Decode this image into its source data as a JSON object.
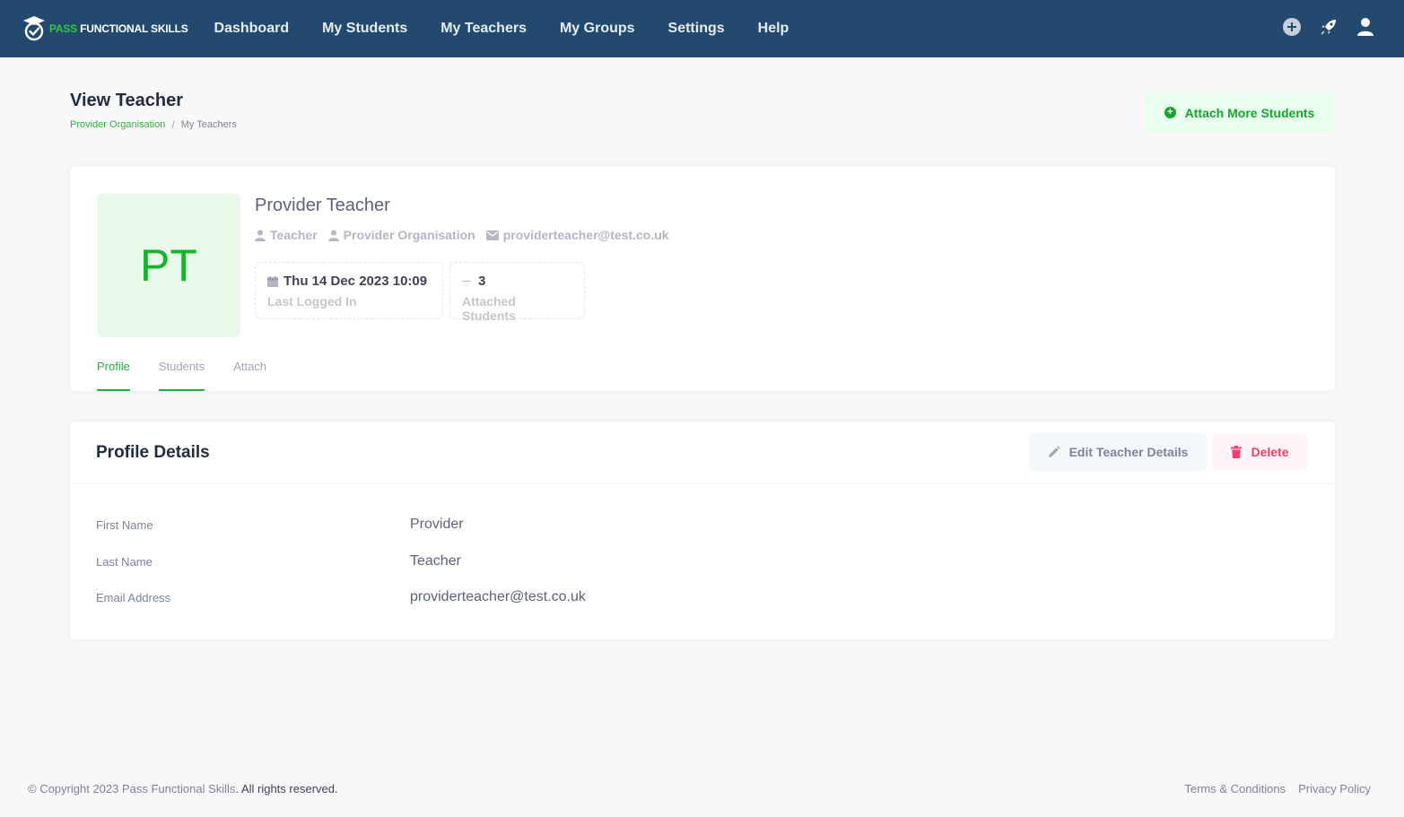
{
  "brand": {
    "part1": "PASS",
    "part2": " FUNCTIONAL SKILLS"
  },
  "nav": {
    "items": [
      {
        "label": "Dashboard"
      },
      {
        "label": "My Students"
      },
      {
        "label": "My Teachers"
      },
      {
        "label": "My Groups"
      },
      {
        "label": "Settings"
      },
      {
        "label": "Help"
      }
    ]
  },
  "header": {
    "title": "View Teacher",
    "breadcrumb": {
      "link": "Provider Organisation",
      "separator": "/",
      "current": "My Teachers"
    },
    "attach_button": "Attach More Students"
  },
  "profile": {
    "initials": "PT",
    "name": "Provider Teacher",
    "role": "Teacher",
    "organisation": "Provider Organisation",
    "email": "providerteacher@test.co.uk",
    "stats": {
      "last_login": {
        "value": "Thu 14 Dec 2023 10:09",
        "label": "Last Logged In"
      },
      "attached": {
        "value": "3",
        "label": "Attached Students"
      }
    },
    "tabs": [
      {
        "label": "Profile"
      },
      {
        "label": "Students"
      },
      {
        "label": "Attach"
      }
    ]
  },
  "details": {
    "title": "Profile Details",
    "edit_button": "Edit Teacher Details",
    "delete_button": "Delete",
    "rows": [
      {
        "label": "First Name",
        "value": "Provider"
      },
      {
        "label": "Last Name",
        "value": "Teacher"
      },
      {
        "label": "Email Address",
        "value": "providerteacher@test.co.uk"
      }
    ]
  },
  "footer": {
    "copyright_prefix": "© Copyright 2023 ",
    "copyright_brand": "Pass Functional Skills",
    "copyright_suffix": ". All rights reserved.",
    "terms": "Terms & Conditions",
    "privacy": "Privacy Policy"
  },
  "colors": {
    "topbar": "#234a6e",
    "accent_green": "#27b23a",
    "danger": "#f1416c"
  }
}
